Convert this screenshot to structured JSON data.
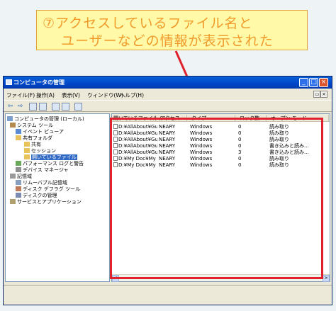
{
  "callout": {
    "line1": "⑦アクセスしているファイル名と",
    "line2": "ユーザーなどの情報が表示された"
  },
  "window": {
    "title": "コンピュータの管理",
    "min_label": "_",
    "max_label": "□",
    "close_label": "×",
    "menus": [
      "ファイル(F)",
      "操作(A)",
      "表示(V)",
      "ウィンドウ(W)",
      "ヘルプ(H)"
    ],
    "mdi_min": "_",
    "mdi_restore": "▭",
    "mdi_close": "×",
    "toolbar": {
      "back": "⇦",
      "forward": "⇨"
    }
  },
  "tree": [
    {
      "label": "コンピュータの管理 (ローカル)",
      "icon": "computer-icon",
      "selected": false
    },
    {
      "label": "システム ツール",
      "icon": "tools-icon",
      "selected": false
    },
    {
      "label": "イベント ビューア",
      "icon": "event-viewer-icon",
      "selected": false
    },
    {
      "label": "共有フォルダ",
      "icon": "shared-folder-icon",
      "selected": false
    },
    {
      "label": "共有",
      "icon": "folder-icon",
      "selected": false
    },
    {
      "label": "セッション",
      "icon": "folder-icon",
      "selected": false
    },
    {
      "label": "開いているファイル",
      "icon": "folder-icon",
      "selected": true
    },
    {
      "label": "パフォーマンス ログと警告",
      "icon": "performance-icon",
      "selected": false
    },
    {
      "label": "デバイス マネージャ",
      "icon": "device-manager-icon",
      "selected": false
    },
    {
      "label": "記憶域",
      "icon": "storage-icon",
      "selected": false
    },
    {
      "label": "リムーバブル記憶域",
      "icon": "removable-storage-icon",
      "selected": false
    },
    {
      "label": "ディスク デフラグ ツール",
      "icon": "defrag-icon",
      "selected": false
    },
    {
      "label": "ディスクの管理",
      "icon": "disk-management-icon",
      "selected": false
    },
    {
      "label": "サービスとアプリケーション",
      "icon": "services-icon",
      "selected": false
    }
  ],
  "columns": [
    "開いているファイル",
    "アクセス",
    "タイプ",
    "ロック数",
    "オープン モード"
  ],
  "sort_indicator": "/",
  "rows": [
    [
      "D:¥AllAbout¥Guid...",
      "NEARY",
      "Windows",
      "0",
      "読み取り"
    ],
    [
      "D:¥AllAbout¥Guid...",
      "NEARY",
      "Windows",
      "0",
      "読み取り"
    ],
    [
      "D:¥AllAbout¥Guid...",
      "NEARY",
      "Windows",
      "0",
      "読み取り"
    ],
    [
      "D:¥AllAbout¥Guid...",
      "NEARY",
      "Windows",
      "0",
      "書き込みと読み..."
    ],
    [
      "D:¥AllAbout¥Guid...",
      "NEARY",
      "Windows",
      "3",
      "書き込みと読み..."
    ],
    [
      "D:¥My Doc¥My P...",
      "NEARY",
      "Windows",
      "0",
      "読み取り"
    ],
    [
      "D:¥My Doc¥My P...",
      "NEARY",
      "Windows",
      "0",
      "読み取り"
    ]
  ],
  "scroll": {
    "left": "<",
    "right": ">"
  },
  "colors": {
    "highlight": "#e0202a",
    "callout_text": "#f09a2a",
    "callout_bg": "#fff9a8",
    "titlebar": "#0046c8"
  }
}
